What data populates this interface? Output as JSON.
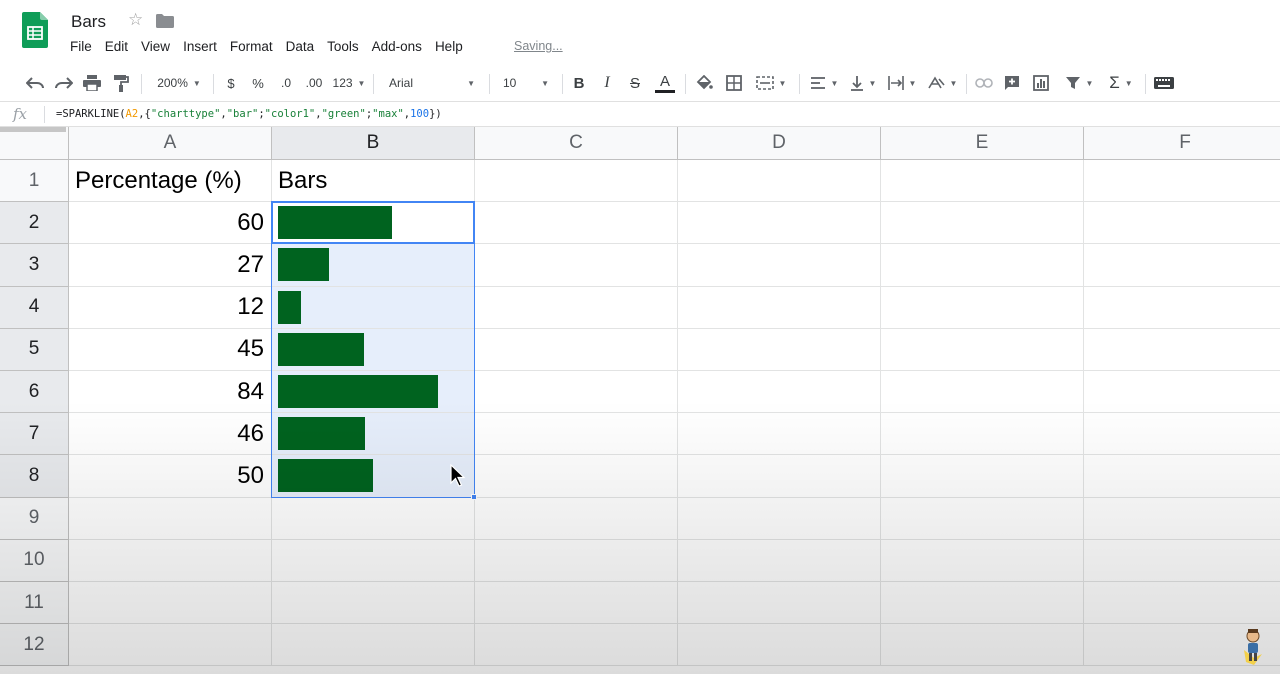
{
  "window": {
    "title": "Bars",
    "saving_status": "Saving..."
  },
  "menu": [
    "File",
    "Edit",
    "View",
    "Insert",
    "Format",
    "Data",
    "Tools",
    "Add-ons",
    "Help"
  ],
  "toolbar": {
    "zoom": "200%",
    "currency": "$",
    "percent": "%",
    "decrease_decimal": ".0",
    "increase_decimal": ".00",
    "more_formats": "123",
    "font": "Arial",
    "font_size": "10",
    "bold": "B",
    "italic": "I",
    "strikethrough": "S",
    "text_color_letter": "A",
    "text_color": "#202124"
  },
  "formula_bar": {
    "fx": "fx",
    "formula_parts": [
      {
        "text": "=SPARKLINE(",
        "kind": "fn"
      },
      {
        "text": "A2",
        "kind": "ref"
      },
      {
        "text": ",{",
        "kind": "fn"
      },
      {
        "text": "\"charttype\"",
        "kind": "str"
      },
      {
        "text": ",",
        "kind": "fn"
      },
      {
        "text": "\"bar\"",
        "kind": "str"
      },
      {
        "text": ";",
        "kind": "fn"
      },
      {
        "text": "\"color1\"",
        "kind": "str"
      },
      {
        "text": ",",
        "kind": "fn"
      },
      {
        "text": "\"green\"",
        "kind": "str"
      },
      {
        "text": ";",
        "kind": "fn"
      },
      {
        "text": "\"max\"",
        "kind": "str"
      },
      {
        "text": ",",
        "kind": "fn"
      },
      {
        "text": "100",
        "kind": "num"
      },
      {
        "text": "})",
        "kind": "fn"
      }
    ]
  },
  "sheet": {
    "columns": [
      "A",
      "B",
      "C",
      "D",
      "E",
      "F"
    ],
    "selected_column": "B",
    "rows": [
      "1",
      "2",
      "3",
      "4",
      "5",
      "6",
      "7",
      "8",
      "9",
      "10",
      "11",
      "12"
    ],
    "selected_rows": [
      "2",
      "3",
      "4",
      "5",
      "6",
      "7",
      "8"
    ],
    "header_a": "Percentage (%)",
    "header_b": "Bars",
    "percentages": [
      60,
      27,
      12,
      45,
      84,
      46,
      50
    ],
    "bar_max": 100,
    "bar_color": "#00631f",
    "active_cell": "B2",
    "selected_range": "B2:B8"
  },
  "colors": {
    "selection": "#4285f4",
    "selection_fill": "#e6eefb",
    "sheets_green": "#0f9d58"
  }
}
